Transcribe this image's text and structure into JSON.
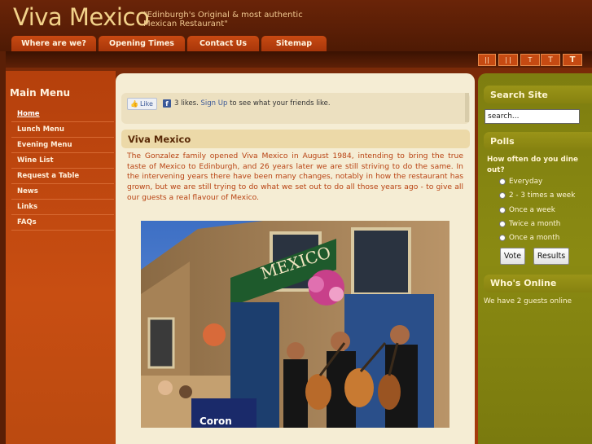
{
  "site": {
    "logo": "Viva Mexico",
    "tagline": "\"Edinburgh's Original & most authentic Mexican Restaurant\""
  },
  "nav": [
    {
      "label": "Where are we?"
    },
    {
      "label": "Opening Times"
    },
    {
      "label": "Contact Us"
    },
    {
      "label": "Sitemap"
    }
  ],
  "font_sizer": [
    "||",
    "| |",
    "T",
    "T",
    "T"
  ],
  "left_menu": {
    "title": "Main Menu",
    "items": [
      {
        "label": "Home",
        "active": true
      },
      {
        "label": "Lunch Menu"
      },
      {
        "label": "Evening Menu"
      },
      {
        "label": "Wine List"
      },
      {
        "label": "Request a Table"
      },
      {
        "label": "News"
      },
      {
        "label": "Links"
      },
      {
        "label": "FAQs"
      }
    ]
  },
  "facebook": {
    "like_label": "Like",
    "count_text": "3 likes.",
    "signup_link": "Sign Up",
    "suffix_text": "to see what your friends like."
  },
  "article": {
    "title": "Viva Mexico",
    "body": "The Gonzalez family opened Viva Mexico in August 1984, intending to bring the true taste of Mexico to Edinburgh, and 26 years later we are still striving to do the same. In the intervening years there have been many changes, notably in how the restaurant has grown, but we are still trying to do what we set out to do all those years ago - to give all our guests a real flavour of Mexico.",
    "photo_sign": "MEXICO",
    "photo_banner": "Coron"
  },
  "search": {
    "title": "Search Site",
    "value": "search..."
  },
  "polls": {
    "title": "Polls",
    "question": "How often do you dine out?",
    "options": [
      "Everyday",
      "2 - 3 times a week",
      "Once a week",
      "Twice a month",
      "Once a month"
    ],
    "vote_label": "Vote",
    "results_label": "Results"
  },
  "online": {
    "title": "Who's Online",
    "text": "We have 2 guests online"
  },
  "colors": {
    "header_bg": "#5a1f06",
    "nav_tab": "#c04410",
    "left_sidebar": "#c04a10",
    "main_bg": "#f5edd4",
    "article_text": "#b84212",
    "right_sidebar": "#848412"
  }
}
